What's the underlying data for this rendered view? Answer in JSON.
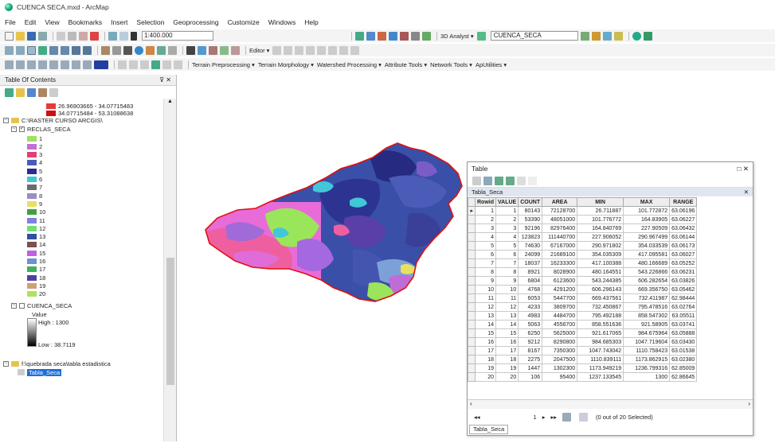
{
  "window": {
    "title": "CUENCA SECA.mxd - ArcMap"
  },
  "menu": [
    "File",
    "Edit",
    "View",
    "Bookmarks",
    "Insert",
    "Selection",
    "Geoprocessing",
    "Customize",
    "Windows",
    "Help"
  ],
  "toolbar": {
    "scale": "1:400.000",
    "analyst": "3D Analyst ▾",
    "layer": "CUENCA_SECA",
    "editor": "Editor ▾"
  },
  "toolbar3": [
    "Terrain Preprocessing ▾",
    "Terrain Morphology ▾",
    "Watershed Processing ▾",
    "Attribute Tools ▾",
    "Network Tools ▾",
    "ApUtilities ▾"
  ],
  "toc": {
    "title": "Table Of Contents",
    "legend_top": [
      {
        "label": "26.96903665 - 34.07715483",
        "color": "#e63a3a"
      },
      {
        "label": "34.07715484 - 53.31088638",
        "color": "#cc1111"
      }
    ],
    "group": "C:\\RASTER CURSO ARCGIS\\",
    "layer": "RECLAS_SECA",
    "classes": [
      {
        "label": "1",
        "color": "#9fe060"
      },
      {
        "label": "2",
        "color": "#c070d8"
      },
      {
        "label": "3",
        "color": "#e04070"
      },
      {
        "label": "4",
        "color": "#4a5cb8"
      },
      {
        "label": "5",
        "color": "#2a2f8a"
      },
      {
        "label": "6",
        "color": "#40c8d8"
      },
      {
        "label": "7",
        "color": "#6b6b6b"
      },
      {
        "label": "8",
        "color": "#9a8fc0"
      },
      {
        "label": "9",
        "color": "#e8e060"
      },
      {
        "label": "10",
        "color": "#40a040"
      },
      {
        "label": "11",
        "color": "#8080e0"
      },
      {
        "label": "12",
        "color": "#70e070"
      },
      {
        "label": "13",
        "color": "#3050a0"
      },
      {
        "label": "14",
        "color": "#7a5050"
      },
      {
        "label": "15",
        "color": "#c060e0"
      },
      {
        "label": "16",
        "color": "#7090d0"
      },
      {
        "label": "17",
        "color": "#40b060"
      },
      {
        "label": "18",
        "color": "#5040a0"
      },
      {
        "label": "19",
        "color": "#d0a070"
      },
      {
        "label": "20",
        "color": "#b0e060"
      }
    ],
    "layer2": "CUENCA_SECA",
    "value_label": "Value",
    "high": "High : 1300",
    "low": "Low : 38.7119",
    "path": "f:\\quebrada seca\\tabla estadistica",
    "table_item": "Tabla_Seca"
  },
  "table": {
    "window_title": "Table",
    "tab_name": "Tabla_Seca",
    "columns": [
      "",
      "Rowid",
      "VALUE",
      "COUNT",
      "AREA",
      "MIN",
      "MAX",
      "RANGE"
    ],
    "rows": [
      [
        "1",
        "1",
        "80143",
        "72128700",
        "26.711887",
        "101.772872",
        "63.06196"
      ],
      [
        "2",
        "2",
        "53390",
        "48051000",
        "101.776772",
        "164.83905",
        "63.06227"
      ],
      [
        "3",
        "3",
        "92196",
        "82976400",
        "164.840769",
        "227.90509",
        "63.06432"
      ],
      [
        "4",
        "4",
        "123823",
        "111440700",
        "227.906052",
        "290.967499",
        "63.06144"
      ],
      [
        "5",
        "5",
        "74630",
        "67167000",
        "290.971802",
        "354.033539",
        "63.06173"
      ],
      [
        "6",
        "6",
        "24099",
        "21689100",
        "354.035309",
        "417.095581",
        "63.06027"
      ],
      [
        "7",
        "7",
        "18037",
        "16233300",
        "417.100388",
        "480.166689",
        "63.05252"
      ],
      [
        "8",
        "8",
        "8921",
        "8028900",
        "480.164551",
        "543.226866",
        "63.06231"
      ],
      [
        "9",
        "9",
        "6804",
        "6123600",
        "543.244385",
        "606.282654",
        "63.03826"
      ],
      [
        "10",
        "10",
        "4768",
        "4291200",
        "606.296143",
        "669.356750",
        "63.05462"
      ],
      [
        "11",
        "11",
        "6053",
        "5447700",
        "669.437561",
        "732.411987",
        "62.98444"
      ],
      [
        "12",
        "12",
        "4233",
        "3809700",
        "732.450867",
        "795.478516",
        "63.02764"
      ],
      [
        "13",
        "13",
        "4983",
        "4484700",
        "795.492188",
        "858.547302",
        "63.05511"
      ],
      [
        "14",
        "14",
        "5063",
        "4556700",
        "858.551636",
        "921.58905",
        "63.03741"
      ],
      [
        "15",
        "15",
        "6250",
        "5625000",
        "921.617065",
        "984.675964",
        "63.05888"
      ],
      [
        "16",
        "16",
        "9212",
        "8290800",
        "984.685303",
        "1047.719604",
        "63.03430"
      ],
      [
        "17",
        "17",
        "8167",
        "7350300",
        "1047.743042",
        "1110.758423",
        "63.01538"
      ],
      [
        "18",
        "18",
        "2275",
        "2047500",
        "1110.839111",
        "1173.862915",
        "63.02380"
      ],
      [
        "19",
        "19",
        "1447",
        "1302300",
        "1173.949219",
        "1236.799316",
        "62.85009"
      ],
      [
        "20",
        "20",
        "106",
        "95400",
        "1237.133545",
        "1300",
        "62.86645"
      ]
    ],
    "nav_page": "1",
    "selected_text": "(0 out of 20 Selected)",
    "bottom_tab": "Tabla_Seca"
  }
}
